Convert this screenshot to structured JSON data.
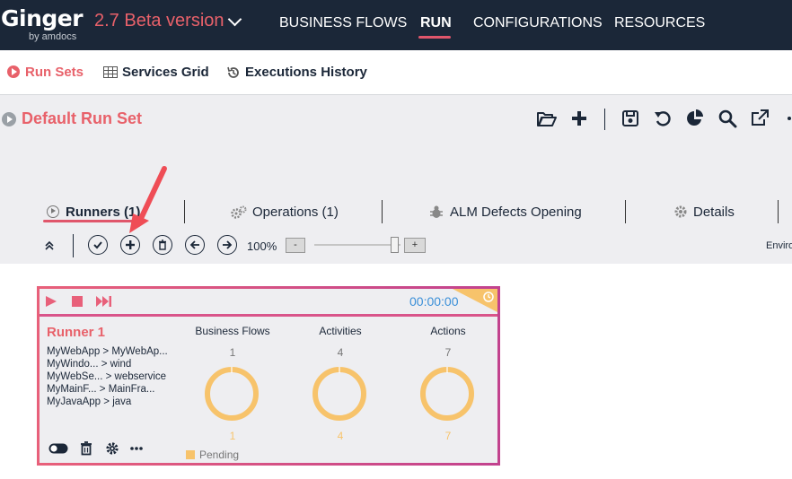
{
  "app": {
    "logo": "Ginger",
    "logo_sub": "by amdocs",
    "version": "2.7 Beta version"
  },
  "topnav": [
    {
      "label": "BUSINESS FLOWS",
      "active": false
    },
    {
      "label": "RUN",
      "active": true
    },
    {
      "label": "CONFIGURATIONS",
      "active": false
    },
    {
      "label": "RESOURCES",
      "active": false
    }
  ],
  "subnav": [
    {
      "label": "Run Sets",
      "icon": "play-circle-icon",
      "active": true
    },
    {
      "label": "Services Grid",
      "icon": "grid-icon",
      "active": false
    },
    {
      "label": "Executions History",
      "icon": "history-icon",
      "active": false
    }
  ],
  "runset": {
    "title": "Default Run Set",
    "toolbar_icons": [
      "folder-open-icon",
      "plus-icon",
      "save-icon",
      "undo-icon",
      "pie-chart-icon",
      "search-icon",
      "external-link-icon",
      "more-icon"
    ]
  },
  "tabs": [
    {
      "label": "Runners (1)",
      "icon": "play-circle-icon",
      "active": true
    },
    {
      "label": "Operations (1)",
      "icon": "gears-icon",
      "active": false
    },
    {
      "label": "ALM Defects Opening",
      "icon": "bug-icon",
      "active": false
    },
    {
      "label": "Details",
      "icon": "gear-icon",
      "active": false
    }
  ],
  "runner_toolbar": {
    "zoom": "100%",
    "zoom_minus": "-",
    "zoom_plus": "+",
    "zoom_level": 0.9,
    "environment_label": "Enviro"
  },
  "runner": {
    "name": "Runner 1",
    "timer": "00:00:00",
    "flows": [
      "MyWebApp > MyWebAp...",
      "MyWindo... > wind",
      "MyWebSe... > webservice",
      "MyMainF... > MainFra...",
      "MyJavaApp > java"
    ],
    "stats": [
      {
        "label": "Business Flows",
        "total": "1",
        "pending": "1"
      },
      {
        "label": "Activities",
        "total": "4",
        "pending": "4"
      },
      {
        "label": "Actions",
        "total": "7",
        "pending": "7"
      }
    ],
    "legend": "Pending",
    "colors": {
      "pending": "#f7c36b",
      "accent": "#e8616a",
      "border": "#d9548a"
    }
  }
}
